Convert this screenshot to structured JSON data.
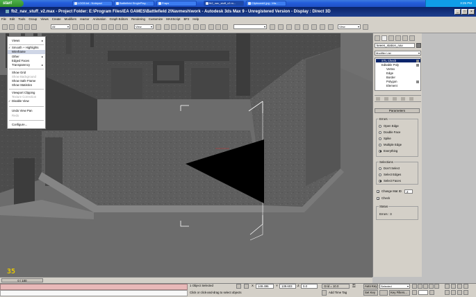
{
  "taskbar": {
    "start_label": "start",
    "tasks": [
      {
        "label": "LOG5.txt - Notepad"
      },
      {
        "label": "Battlefield SinglePlay..."
      },
      {
        "label": "Fraps"
      },
      {
        "label": "fb2_nav_stuff_v2.m..."
      },
      {
        "label": "Clipboard4.jpg - Irfa..."
      }
    ],
    "clock": "3:25 PM"
  },
  "window": {
    "title": "fb2_nav_stuff_v2.max   - Project Folder: E:\\Program Files\\EA GAMES\\Battlefield 2\\Navmesh\\work   - Autodesk 3ds Max 9  - Unregistered Version   - Display : Direct 3D"
  },
  "menubar": [
    "File",
    "Edit",
    "Tools",
    "Group",
    "Views",
    "Create",
    "Modifiers",
    "reactor",
    "Animation",
    "Graph Editors",
    "Rendering",
    "Customize",
    "MAXScript",
    "BF2",
    "Help"
  ],
  "toolbar": {
    "selection_filter": "All",
    "coordinate_system": "View",
    "pivot_dropdown": "View"
  },
  "viewport": {
    "fps_overlay": "35"
  },
  "context_menu": {
    "items": [
      {
        "label": "Views",
        "submenu": true,
        "checked": false,
        "disabled": false,
        "highlighted": false
      },
      {
        "sep": true
      },
      {
        "label": "Smooth + Highlights",
        "checked": true,
        "disabled": false,
        "highlighted": false
      },
      {
        "label": "Wireframe",
        "checked": false,
        "disabled": false,
        "highlighted": true
      },
      {
        "label": "Other",
        "submenu": true,
        "checked": false,
        "disabled": false,
        "highlighted": false
      },
      {
        "label": "Edged Faces",
        "checked": false,
        "disabled": false,
        "highlighted": false
      },
      {
        "label": "Transparency",
        "submenu": true,
        "checked": false,
        "disabled": false,
        "highlighted": false
      },
      {
        "sep": true
      },
      {
        "label": "Show Grid",
        "checked": false,
        "disabled": false,
        "highlighted": false
      },
      {
        "label": "Show Background",
        "checked": false,
        "disabled": true,
        "highlighted": false
      },
      {
        "label": "Show Safe Frame",
        "checked": false,
        "disabled": false,
        "highlighted": false
      },
      {
        "label": "Show Statistics",
        "checked": false,
        "disabled": false,
        "highlighted": false
      },
      {
        "sep": true
      },
      {
        "label": "Viewport Clipping",
        "checked": false,
        "disabled": false,
        "highlighted": false
      },
      {
        "label": "Texture Correction",
        "checked": false,
        "disabled": true,
        "highlighted": false
      },
      {
        "label": "Disable View",
        "checked": true,
        "disabled": false,
        "highlighted": false
      },
      {
        "sep": true
      },
      {
        "label": "Undo View Pan",
        "checked": false,
        "disabled": false,
        "highlighted": false
      },
      {
        "label": "Redo",
        "checked": false,
        "disabled": true,
        "highlighted": false
      },
      {
        "sep": true
      },
      {
        "label": "Configure...",
        "checked": false,
        "disabled": false,
        "highlighted": false
      }
    ]
  },
  "command_panel": {
    "object_name": "keeen_station_nav",
    "modifier_list_label": "Modifier List",
    "stack": [
      {
        "label": "STL Check"
      },
      {
        "label": "Editable Poly"
      },
      {
        "label": "Vertex"
      },
      {
        "label": "Edge"
      },
      {
        "label": "Border"
      },
      {
        "label": "Polygon"
      },
      {
        "label": "Element"
      }
    ],
    "parameters": {
      "header": "Parameters",
      "errors_group": "Errors",
      "errors_options": [
        {
          "label": "Open Edge",
          "selected": false
        },
        {
          "label": "Double Face",
          "selected": false
        },
        {
          "label": "Spike",
          "selected": false
        },
        {
          "label": "Multiple Edge",
          "selected": false
        },
        {
          "label": "Everything",
          "selected": true
        }
      ],
      "selections_group": "Selections",
      "selections_options": [
        {
          "label": "Don't Select",
          "selected": false
        },
        {
          "label": "Select Edges",
          "selected": false
        },
        {
          "label": "Select Faces",
          "selected": true
        }
      ],
      "change_mat_id_label": "Change Mat ID",
      "change_mat_id_value": "2",
      "check_label": "Check",
      "status_group": "Status",
      "status_text": "Errors : 3"
    }
  },
  "timeline": {
    "frame": "0 / 100"
  },
  "statusbar": {
    "selection_info": "1 Object Selected",
    "prompt": "Click or click-and-drag to select objects",
    "x_value": "149.496",
    "y_value": "139.603",
    "z_value": "0.0",
    "grid": "Grid = 10.0",
    "add_time_tag": "Add Time Tag",
    "auto_key": "Auto Key",
    "set_key": "Set Key",
    "selected_dropdown": "Selected",
    "key_filters": "Key Filters..."
  }
}
